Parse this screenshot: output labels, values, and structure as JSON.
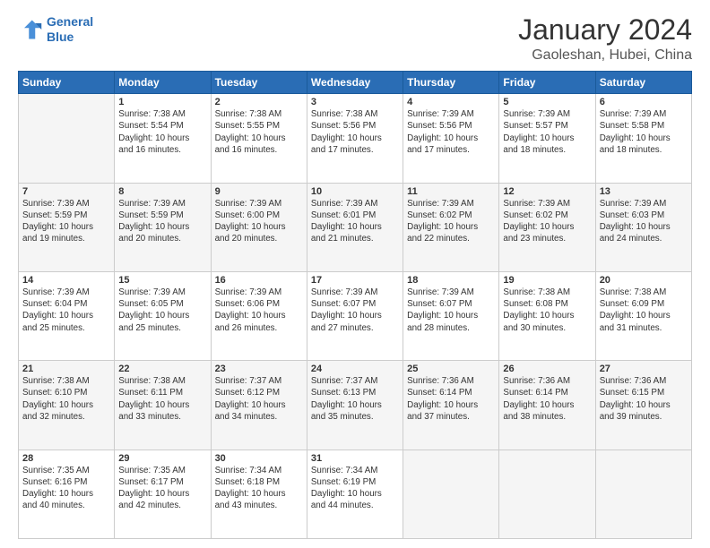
{
  "header": {
    "logo_line1": "General",
    "logo_line2": "Blue",
    "title": "January 2024",
    "subtitle": "Gaoleshan, Hubei, China"
  },
  "weekdays": [
    "Sunday",
    "Monday",
    "Tuesday",
    "Wednesday",
    "Thursday",
    "Friday",
    "Saturday"
  ],
  "weeks": [
    [
      {
        "day": "",
        "info": ""
      },
      {
        "day": "1",
        "info": "Sunrise: 7:38 AM\nSunset: 5:54 PM\nDaylight: 10 hours\nand 16 minutes."
      },
      {
        "day": "2",
        "info": "Sunrise: 7:38 AM\nSunset: 5:55 PM\nDaylight: 10 hours\nand 16 minutes."
      },
      {
        "day": "3",
        "info": "Sunrise: 7:38 AM\nSunset: 5:56 PM\nDaylight: 10 hours\nand 17 minutes."
      },
      {
        "day": "4",
        "info": "Sunrise: 7:39 AM\nSunset: 5:56 PM\nDaylight: 10 hours\nand 17 minutes."
      },
      {
        "day": "5",
        "info": "Sunrise: 7:39 AM\nSunset: 5:57 PM\nDaylight: 10 hours\nand 18 minutes."
      },
      {
        "day": "6",
        "info": "Sunrise: 7:39 AM\nSunset: 5:58 PM\nDaylight: 10 hours\nand 18 minutes."
      }
    ],
    [
      {
        "day": "7",
        "info": "Sunrise: 7:39 AM\nSunset: 5:59 PM\nDaylight: 10 hours\nand 19 minutes."
      },
      {
        "day": "8",
        "info": "Sunrise: 7:39 AM\nSunset: 5:59 PM\nDaylight: 10 hours\nand 20 minutes."
      },
      {
        "day": "9",
        "info": "Sunrise: 7:39 AM\nSunset: 6:00 PM\nDaylight: 10 hours\nand 20 minutes."
      },
      {
        "day": "10",
        "info": "Sunrise: 7:39 AM\nSunset: 6:01 PM\nDaylight: 10 hours\nand 21 minutes."
      },
      {
        "day": "11",
        "info": "Sunrise: 7:39 AM\nSunset: 6:02 PM\nDaylight: 10 hours\nand 22 minutes."
      },
      {
        "day": "12",
        "info": "Sunrise: 7:39 AM\nSunset: 6:02 PM\nDaylight: 10 hours\nand 23 minutes."
      },
      {
        "day": "13",
        "info": "Sunrise: 7:39 AM\nSunset: 6:03 PM\nDaylight: 10 hours\nand 24 minutes."
      }
    ],
    [
      {
        "day": "14",
        "info": "Sunrise: 7:39 AM\nSunset: 6:04 PM\nDaylight: 10 hours\nand 25 minutes."
      },
      {
        "day": "15",
        "info": "Sunrise: 7:39 AM\nSunset: 6:05 PM\nDaylight: 10 hours\nand 25 minutes."
      },
      {
        "day": "16",
        "info": "Sunrise: 7:39 AM\nSunset: 6:06 PM\nDaylight: 10 hours\nand 26 minutes."
      },
      {
        "day": "17",
        "info": "Sunrise: 7:39 AM\nSunset: 6:07 PM\nDaylight: 10 hours\nand 27 minutes."
      },
      {
        "day": "18",
        "info": "Sunrise: 7:39 AM\nSunset: 6:07 PM\nDaylight: 10 hours\nand 28 minutes."
      },
      {
        "day": "19",
        "info": "Sunrise: 7:38 AM\nSunset: 6:08 PM\nDaylight: 10 hours\nand 30 minutes."
      },
      {
        "day": "20",
        "info": "Sunrise: 7:38 AM\nSunset: 6:09 PM\nDaylight: 10 hours\nand 31 minutes."
      }
    ],
    [
      {
        "day": "21",
        "info": "Sunrise: 7:38 AM\nSunset: 6:10 PM\nDaylight: 10 hours\nand 32 minutes."
      },
      {
        "day": "22",
        "info": "Sunrise: 7:38 AM\nSunset: 6:11 PM\nDaylight: 10 hours\nand 33 minutes."
      },
      {
        "day": "23",
        "info": "Sunrise: 7:37 AM\nSunset: 6:12 PM\nDaylight: 10 hours\nand 34 minutes."
      },
      {
        "day": "24",
        "info": "Sunrise: 7:37 AM\nSunset: 6:13 PM\nDaylight: 10 hours\nand 35 minutes."
      },
      {
        "day": "25",
        "info": "Sunrise: 7:36 AM\nSunset: 6:14 PM\nDaylight: 10 hours\nand 37 minutes."
      },
      {
        "day": "26",
        "info": "Sunrise: 7:36 AM\nSunset: 6:14 PM\nDaylight: 10 hours\nand 38 minutes."
      },
      {
        "day": "27",
        "info": "Sunrise: 7:36 AM\nSunset: 6:15 PM\nDaylight: 10 hours\nand 39 minutes."
      }
    ],
    [
      {
        "day": "28",
        "info": "Sunrise: 7:35 AM\nSunset: 6:16 PM\nDaylight: 10 hours\nand 40 minutes."
      },
      {
        "day": "29",
        "info": "Sunrise: 7:35 AM\nSunset: 6:17 PM\nDaylight: 10 hours\nand 42 minutes."
      },
      {
        "day": "30",
        "info": "Sunrise: 7:34 AM\nSunset: 6:18 PM\nDaylight: 10 hours\nand 43 minutes."
      },
      {
        "day": "31",
        "info": "Sunrise: 7:34 AM\nSunset: 6:19 PM\nDaylight: 10 hours\nand 44 minutes."
      },
      {
        "day": "",
        "info": ""
      },
      {
        "day": "",
        "info": ""
      },
      {
        "day": "",
        "info": ""
      }
    ]
  ]
}
